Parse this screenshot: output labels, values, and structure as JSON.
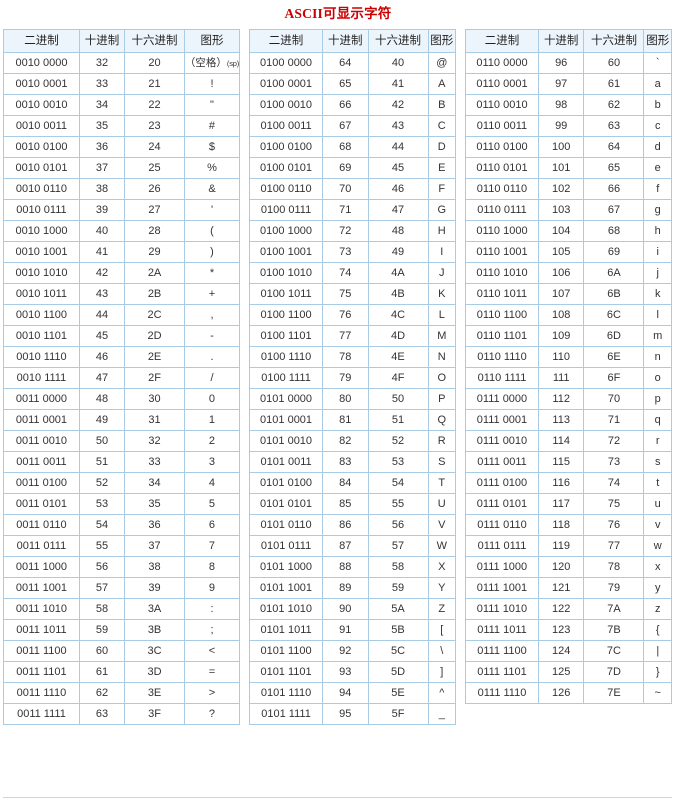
{
  "page": {
    "title": "ASCII可显示字符",
    "title_color": "#cc0000",
    "header_bg": "#edf5fc",
    "border_color": "#a9cce6"
  },
  "columns": {
    "binary": "二进制",
    "decimal": "十进制",
    "hex": "十六进制",
    "glyph": "图形"
  },
  "tables": [
    {
      "id": "table-32-63",
      "rows": [
        {
          "binary": "0010 0000",
          "decimal": "32",
          "hex": "20",
          "glyph": "（空格）",
          "glyph_note": "(sp)"
        },
        {
          "binary": "0010 0001",
          "decimal": "33",
          "hex": "21",
          "glyph": "!"
        },
        {
          "binary": "0010 0010",
          "decimal": "34",
          "hex": "22",
          "glyph": "\""
        },
        {
          "binary": "0010 0011",
          "decimal": "35",
          "hex": "23",
          "glyph": "#"
        },
        {
          "binary": "0010 0100",
          "decimal": "36",
          "hex": "24",
          "glyph": "$"
        },
        {
          "binary": "0010 0101",
          "decimal": "37",
          "hex": "25",
          "glyph": "%"
        },
        {
          "binary": "0010 0110",
          "decimal": "38",
          "hex": "26",
          "glyph": "&"
        },
        {
          "binary": "0010 0111",
          "decimal": "39",
          "hex": "27",
          "glyph": "'"
        },
        {
          "binary": "0010 1000",
          "decimal": "40",
          "hex": "28",
          "glyph": "("
        },
        {
          "binary": "0010 1001",
          "decimal": "41",
          "hex": "29",
          "glyph": ")"
        },
        {
          "binary": "0010 1010",
          "decimal": "42",
          "hex": "2A",
          "glyph": "*"
        },
        {
          "binary": "0010 1011",
          "decimal": "43",
          "hex": "2B",
          "glyph": "+"
        },
        {
          "binary": "0010 1100",
          "decimal": "44",
          "hex": "2C",
          "glyph": ","
        },
        {
          "binary": "0010 1101",
          "decimal": "45",
          "hex": "2D",
          "glyph": "-"
        },
        {
          "binary": "0010 1110",
          "decimal": "46",
          "hex": "2E",
          "glyph": "."
        },
        {
          "binary": "0010 1111",
          "decimal": "47",
          "hex": "2F",
          "glyph": "/"
        },
        {
          "binary": "0011 0000",
          "decimal": "48",
          "hex": "30",
          "glyph": "0"
        },
        {
          "binary": "0011 0001",
          "decimal": "49",
          "hex": "31",
          "glyph": "1"
        },
        {
          "binary": "0011 0010",
          "decimal": "50",
          "hex": "32",
          "glyph": "2"
        },
        {
          "binary": "0011 0011",
          "decimal": "51",
          "hex": "33",
          "glyph": "3"
        },
        {
          "binary": "0011 0100",
          "decimal": "52",
          "hex": "34",
          "glyph": "4"
        },
        {
          "binary": "0011 0101",
          "decimal": "53",
          "hex": "35",
          "glyph": "5"
        },
        {
          "binary": "0011 0110",
          "decimal": "54",
          "hex": "36",
          "glyph": "6"
        },
        {
          "binary": "0011 0111",
          "decimal": "55",
          "hex": "37",
          "glyph": "7"
        },
        {
          "binary": "0011 1000",
          "decimal": "56",
          "hex": "38",
          "glyph": "8"
        },
        {
          "binary": "0011 1001",
          "decimal": "57",
          "hex": "39",
          "glyph": "9"
        },
        {
          "binary": "0011 1010",
          "decimal": "58",
          "hex": "3A",
          "glyph": ":"
        },
        {
          "binary": "0011 1011",
          "decimal": "59",
          "hex": "3B",
          "glyph": ";"
        },
        {
          "binary": "0011 1100",
          "decimal": "60",
          "hex": "3C",
          "glyph": "<"
        },
        {
          "binary": "0011 1101",
          "decimal": "61",
          "hex": "3D",
          "glyph": "="
        },
        {
          "binary": "0011 1110",
          "decimal": "62",
          "hex": "3E",
          "glyph": ">"
        },
        {
          "binary": "0011 1111",
          "decimal": "63",
          "hex": "3F",
          "glyph": "?"
        }
      ]
    },
    {
      "id": "table-64-95",
      "rows": [
        {
          "binary": "0100 0000",
          "decimal": "64",
          "hex": "40",
          "glyph": "@"
        },
        {
          "binary": "0100 0001",
          "decimal": "65",
          "hex": "41",
          "glyph": "A"
        },
        {
          "binary": "0100 0010",
          "decimal": "66",
          "hex": "42",
          "glyph": "B"
        },
        {
          "binary": "0100 0011",
          "decimal": "67",
          "hex": "43",
          "glyph": "C"
        },
        {
          "binary": "0100 0100",
          "decimal": "68",
          "hex": "44",
          "glyph": "D"
        },
        {
          "binary": "0100 0101",
          "decimal": "69",
          "hex": "45",
          "glyph": "E"
        },
        {
          "binary": "0100 0110",
          "decimal": "70",
          "hex": "46",
          "glyph": "F"
        },
        {
          "binary": "0100 0111",
          "decimal": "71",
          "hex": "47",
          "glyph": "G"
        },
        {
          "binary": "0100 1000",
          "decimal": "72",
          "hex": "48",
          "glyph": "H"
        },
        {
          "binary": "0100 1001",
          "decimal": "73",
          "hex": "49",
          "glyph": "I"
        },
        {
          "binary": "0100 1010",
          "decimal": "74",
          "hex": "4A",
          "glyph": "J"
        },
        {
          "binary": "0100 1011",
          "decimal": "75",
          "hex": "4B",
          "glyph": "K"
        },
        {
          "binary": "0100 1100",
          "decimal": "76",
          "hex": "4C",
          "glyph": "L"
        },
        {
          "binary": "0100 1101",
          "decimal": "77",
          "hex": "4D",
          "glyph": "M"
        },
        {
          "binary": "0100 1110",
          "decimal": "78",
          "hex": "4E",
          "glyph": "N"
        },
        {
          "binary": "0100 1111",
          "decimal": "79",
          "hex": "4F",
          "glyph": "O"
        },
        {
          "binary": "0101 0000",
          "decimal": "80",
          "hex": "50",
          "glyph": "P"
        },
        {
          "binary": "0101 0001",
          "decimal": "81",
          "hex": "51",
          "glyph": "Q"
        },
        {
          "binary": "0101 0010",
          "decimal": "82",
          "hex": "52",
          "glyph": "R"
        },
        {
          "binary": "0101 0011",
          "decimal": "83",
          "hex": "53",
          "glyph": "S"
        },
        {
          "binary": "0101 0100",
          "decimal": "84",
          "hex": "54",
          "glyph": "T"
        },
        {
          "binary": "0101 0101",
          "decimal": "85",
          "hex": "55",
          "glyph": "U"
        },
        {
          "binary": "0101 0110",
          "decimal": "86",
          "hex": "56",
          "glyph": "V"
        },
        {
          "binary": "0101 0111",
          "decimal": "87",
          "hex": "57",
          "glyph": "W"
        },
        {
          "binary": "0101 1000",
          "decimal": "88",
          "hex": "58",
          "glyph": "X"
        },
        {
          "binary": "0101 1001",
          "decimal": "89",
          "hex": "59",
          "glyph": "Y"
        },
        {
          "binary": "0101 1010",
          "decimal": "90",
          "hex": "5A",
          "glyph": "Z"
        },
        {
          "binary": "0101 1011",
          "decimal": "91",
          "hex": "5B",
          "glyph": "["
        },
        {
          "binary": "0101 1100",
          "decimal": "92",
          "hex": "5C",
          "glyph": "\\"
        },
        {
          "binary": "0101 1101",
          "decimal": "93",
          "hex": "5D",
          "glyph": "]"
        },
        {
          "binary": "0101 1110",
          "decimal": "94",
          "hex": "5E",
          "glyph": "^"
        },
        {
          "binary": "0101 1111",
          "decimal": "95",
          "hex": "5F",
          "glyph": "_"
        }
      ]
    },
    {
      "id": "table-96-126",
      "rows": [
        {
          "binary": "0110 0000",
          "decimal": "96",
          "hex": "60",
          "glyph": "`"
        },
        {
          "binary": "0110 0001",
          "decimal": "97",
          "hex": "61",
          "glyph": "a"
        },
        {
          "binary": "0110 0010",
          "decimal": "98",
          "hex": "62",
          "glyph": "b"
        },
        {
          "binary": "0110 0011",
          "decimal": "99",
          "hex": "63",
          "glyph": "c"
        },
        {
          "binary": "0110 0100",
          "decimal": "100",
          "hex": "64",
          "glyph": "d"
        },
        {
          "binary": "0110 0101",
          "decimal": "101",
          "hex": "65",
          "glyph": "e"
        },
        {
          "binary": "0110 0110",
          "decimal": "102",
          "hex": "66",
          "glyph": "f"
        },
        {
          "binary": "0110 0111",
          "decimal": "103",
          "hex": "67",
          "glyph": "g"
        },
        {
          "binary": "0110 1000",
          "decimal": "104",
          "hex": "68",
          "glyph": "h"
        },
        {
          "binary": "0110 1001",
          "decimal": "105",
          "hex": "69",
          "glyph": "i"
        },
        {
          "binary": "0110 1010",
          "decimal": "106",
          "hex": "6A",
          "glyph": "j"
        },
        {
          "binary": "0110 1011",
          "decimal": "107",
          "hex": "6B",
          "glyph": "k"
        },
        {
          "binary": "0110 1100",
          "decimal": "108",
          "hex": "6C",
          "glyph": "l"
        },
        {
          "binary": "0110 1101",
          "decimal": "109",
          "hex": "6D",
          "glyph": "m"
        },
        {
          "binary": "0110 1110",
          "decimal": "110",
          "hex": "6E",
          "glyph": "n"
        },
        {
          "binary": "0110 1111",
          "decimal": "111",
          "hex": "6F",
          "glyph": "o"
        },
        {
          "binary": "0111 0000",
          "decimal": "112",
          "hex": "70",
          "glyph": "p"
        },
        {
          "binary": "0111 0001",
          "decimal": "113",
          "hex": "71",
          "glyph": "q"
        },
        {
          "binary": "0111 0010",
          "decimal": "114",
          "hex": "72",
          "glyph": "r"
        },
        {
          "binary": "0111 0011",
          "decimal": "115",
          "hex": "73",
          "glyph": "s"
        },
        {
          "binary": "0111 0100",
          "decimal": "116",
          "hex": "74",
          "glyph": "t"
        },
        {
          "binary": "0111 0101",
          "decimal": "117",
          "hex": "75",
          "glyph": "u"
        },
        {
          "binary": "0111 0110",
          "decimal": "118",
          "hex": "76",
          "glyph": "v"
        },
        {
          "binary": "0111 0111",
          "decimal": "119",
          "hex": "77",
          "glyph": "w"
        },
        {
          "binary": "0111 1000",
          "decimal": "120",
          "hex": "78",
          "glyph": "x"
        },
        {
          "binary": "0111 1001",
          "decimal": "121",
          "hex": "79",
          "glyph": "y"
        },
        {
          "binary": "0111 1010",
          "decimal": "122",
          "hex": "7A",
          "glyph": "z"
        },
        {
          "binary": "0111 1011",
          "decimal": "123",
          "hex": "7B",
          "glyph": "{"
        },
        {
          "binary": "0111 1100",
          "decimal": "124",
          "hex": "7C",
          "glyph": "|"
        },
        {
          "binary": "0111 1101",
          "decimal": "125",
          "hex": "7D",
          "glyph": "}"
        },
        {
          "binary": "0111 1110",
          "decimal": "126",
          "hex": "7E",
          "glyph": "~"
        }
      ]
    }
  ]
}
